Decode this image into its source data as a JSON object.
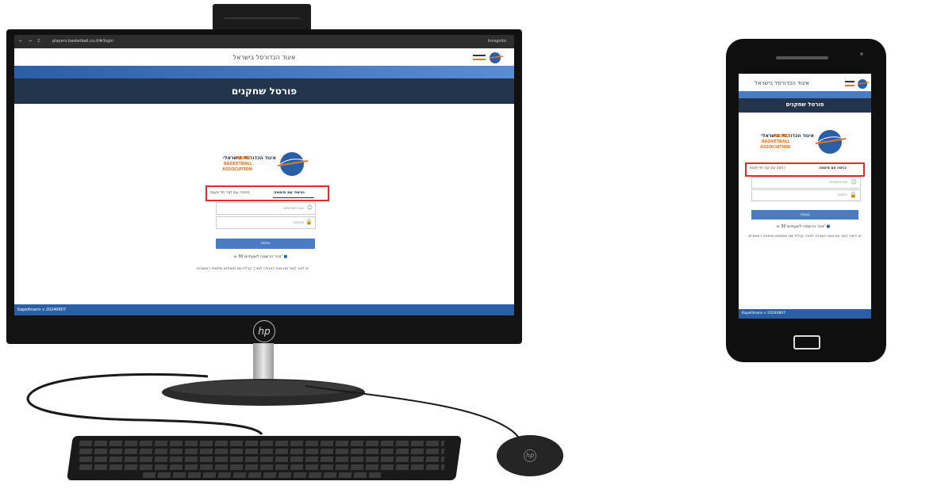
{
  "desktop": {
    "browser": {
      "nav_buttons": "← → C",
      "url": "players.basketball.co.il/#/login",
      "right_text": "Incognito"
    },
    "site_title": "איגוד הכדורסל בישראל",
    "portal_title": "פורטל שחקנים",
    "logo": {
      "hebrew": "איגוד הכדורסל הישראלי",
      "english_lines": [
        "ISRAELI",
        "BASKETBALL",
        "ASSOCIATION"
      ]
    },
    "tabs": {
      "password_login": "כניסה עם סיסמה",
      "otp_login": "כניסה עם קוד חד פעמי"
    },
    "fields": {
      "username_placeholder": "שם משתמש",
      "password_placeholder": "סיסמה"
    },
    "login_button": "כניסה",
    "remember": "זכור הרשמה לשעתיים 30 ש'",
    "note": "יש לצור קשר עם צוות האגודה לצורך קבלת שם משתמש וסיסמה ראשוניים",
    "footer_version": "Kapellmann v 20240807",
    "brand_mark": "hp"
  },
  "phone": {
    "site_title": "איגוד הכדורסל בישראל",
    "portal_title": "פורטל שחקנים",
    "logo": {
      "hebrew": "איגוד הכדורסל הישראלי",
      "english_lines": [
        "ISRAELI",
        "BASKETBALL",
        "ASSOCIATION"
      ]
    },
    "tabs": {
      "password_login": "כניסה עם סיסמה",
      "otp_login": "כניסה עם קוד חד-פעמי"
    },
    "fields": {
      "username_placeholder": "שם משתמש",
      "password_placeholder": "סיסמה"
    },
    "login_button": "כניסה",
    "remember": "זכור הרשמה לשעתיים 30 ש'",
    "note": "יש ליצור קשר עם צוות האגודה לצורך קבלת שם משתמש וסיסמה ראשוניים",
    "footer_version": "Kapellmann v 20240807"
  },
  "colors": {
    "accent_blue": "#4a7cc4",
    "dark_navy": "#22354d",
    "highlight_red": "#e32b2b",
    "logo_orange": "#e8742a"
  }
}
